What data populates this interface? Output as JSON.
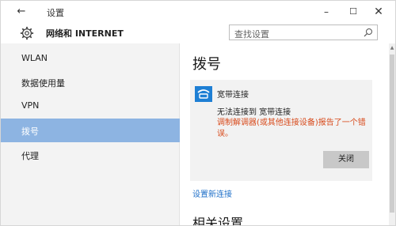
{
  "window": {
    "title": "设置",
    "back_glyph": "←",
    "minimize_glyph": "–",
    "maximize_glyph": "☐",
    "close_glyph": "✕"
  },
  "header": {
    "section_title": "网络和 INTERNET",
    "search_placeholder": "查找设置"
  },
  "sidebar": {
    "items": [
      {
        "label": "WLAN",
        "selected": false
      },
      {
        "label": "数据使用量",
        "selected": false
      },
      {
        "label": "VPN",
        "selected": false
      },
      {
        "label": "拨号",
        "selected": true
      },
      {
        "label": "代理",
        "selected": false
      }
    ]
  },
  "main": {
    "heading": "拨号",
    "connection": {
      "name": "宽带连接",
      "status": "无法连接到 宽带连接",
      "error": "调制解调器(或其他连接设备)报告了一个错误。",
      "close_label": "关闭"
    },
    "setup_link": "设置新连接",
    "related_heading": "相关设置"
  },
  "colors": {
    "selected_bg": "#8db4e2",
    "icon_blue": "#1e7fd4",
    "error_text": "#d84a1b",
    "link": "#1e6fc8"
  }
}
